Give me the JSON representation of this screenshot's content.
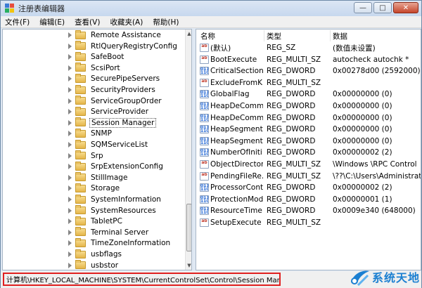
{
  "window": {
    "title": "注册表编辑器",
    "buttons": {
      "minimize": "—",
      "maximize": "□",
      "close": "✕"
    }
  },
  "menu": [
    {
      "label": "文件(F)"
    },
    {
      "label": "编辑(E)"
    },
    {
      "label": "查看(V)"
    },
    {
      "label": "收藏夹(A)"
    },
    {
      "label": "帮助(H)"
    }
  ],
  "tree": {
    "items": [
      {
        "label": "Remote Assistance"
      },
      {
        "label": "RtlQueryRegistryConfig"
      },
      {
        "label": "SafeBoot"
      },
      {
        "label": "ScsiPort"
      },
      {
        "label": "SecurePipeServers"
      },
      {
        "label": "SecurityProviders"
      },
      {
        "label": "ServiceGroupOrder"
      },
      {
        "label": "ServiceProvider"
      },
      {
        "label": "Session Manager",
        "selected": true
      },
      {
        "label": "SNMP"
      },
      {
        "label": "SQMServiceList"
      },
      {
        "label": "Srp"
      },
      {
        "label": "SrpExtensionConfig"
      },
      {
        "label": "StillImage"
      },
      {
        "label": "Storage"
      },
      {
        "label": "SystemInformation"
      },
      {
        "label": "SystemResources"
      },
      {
        "label": "TabletPC"
      },
      {
        "label": "Terminal Server"
      },
      {
        "label": "TimeZoneInformation"
      },
      {
        "label": "usbflags"
      },
      {
        "label": "usbstor"
      }
    ]
  },
  "list": {
    "columns": {
      "name": "名称",
      "type": "类型",
      "data": "数据"
    },
    "rows": [
      {
        "icon": "string-value-icon",
        "name": "(默认)",
        "type": "REG_SZ",
        "data": "(数值未设置)"
      },
      {
        "icon": "string-value-icon",
        "name": "BootExecute",
        "type": "REG_MULTI_SZ",
        "data": "autocheck autochk *"
      },
      {
        "icon": "binary-value-icon",
        "name": "CriticalSection...",
        "type": "REG_DWORD",
        "data": "0x00278d00 (2592000)"
      },
      {
        "icon": "string-value-icon",
        "name": "ExcludeFromK...",
        "type": "REG_MULTI_SZ",
        "data": ""
      },
      {
        "icon": "binary-value-icon",
        "name": "GlobalFlag",
        "type": "REG_DWORD",
        "data": "0x00000000 (0)"
      },
      {
        "icon": "binary-value-icon",
        "name": "HeapDeComm...",
        "type": "REG_DWORD",
        "data": "0x00000000 (0)"
      },
      {
        "icon": "binary-value-icon",
        "name": "HeapDeComm...",
        "type": "REG_DWORD",
        "data": "0x00000000 (0)"
      },
      {
        "icon": "binary-value-icon",
        "name": "HeapSegment...",
        "type": "REG_DWORD",
        "data": "0x00000000 (0)"
      },
      {
        "icon": "binary-value-icon",
        "name": "HeapSegment...",
        "type": "REG_DWORD",
        "data": "0x00000000 (0)"
      },
      {
        "icon": "binary-value-icon",
        "name": "NumberOfIniti...",
        "type": "REG_DWORD",
        "data": "0x00000002 (2)"
      },
      {
        "icon": "string-value-icon",
        "name": "ObjectDirector...",
        "type": "REG_MULTI_SZ",
        "data": "\\Windows \\RPC Control"
      },
      {
        "icon": "string-value-icon",
        "name": "PendingFileRe...",
        "type": "REG_MULTI_SZ",
        "data": "\\??\\C:\\Users\\Administrator"
      },
      {
        "icon": "binary-value-icon",
        "name": "ProcessorCont...",
        "type": "REG_DWORD",
        "data": "0x00000002 (2)"
      },
      {
        "icon": "binary-value-icon",
        "name": "ProtectionMode",
        "type": "REG_DWORD",
        "data": "0x00000001 (1)"
      },
      {
        "icon": "binary-value-icon",
        "name": "ResourceTime...",
        "type": "REG_DWORD",
        "data": "0x0009e340 (648000)"
      },
      {
        "icon": "string-value-icon",
        "name": "SetupExecute",
        "type": "REG_MULTI_SZ",
        "data": ""
      }
    ]
  },
  "status": {
    "path": "计算机\\HKEY_LOCAL_MACHINE\\SYSTEM\\CurrentControlSet\\Control\\Session Manager",
    "highlight_color": "#e02020"
  },
  "watermark": {
    "text": "系统天地",
    "color": "#1b7fd1"
  }
}
